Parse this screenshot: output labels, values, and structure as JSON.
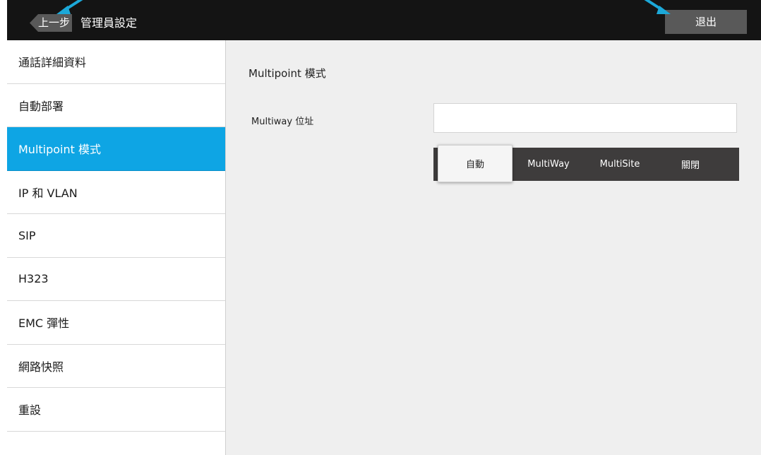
{
  "header": {
    "back_label": "上一步",
    "title": "管理員設定",
    "exit_label": "退出",
    "arrow_color": "#1ca8d8"
  },
  "sidebar": {
    "active_index": 2,
    "items": [
      {
        "label": "通話詳細資料"
      },
      {
        "label": "自動部署"
      },
      {
        "label": "Multipoint 模式"
      },
      {
        "label": "IP 和 VLAN"
      },
      {
        "label": "SIP"
      },
      {
        "label": "H323"
      },
      {
        "label": "EMC 彈性"
      },
      {
        "label": "網路快照"
      },
      {
        "label": "重設"
      },
      {
        "label": ""
      }
    ]
  },
  "main": {
    "section_title": "Multipoint 模式",
    "address_label": "Multiway 位址",
    "address_value": "",
    "mode_options": [
      "自動",
      "MultiWay",
      "MultiSite",
      "關閉"
    ],
    "selected_mode": "自動"
  },
  "colors": {
    "accent": "#0ea5e4",
    "topbar": "#141414",
    "segment_bg": "#3e3c3c"
  }
}
